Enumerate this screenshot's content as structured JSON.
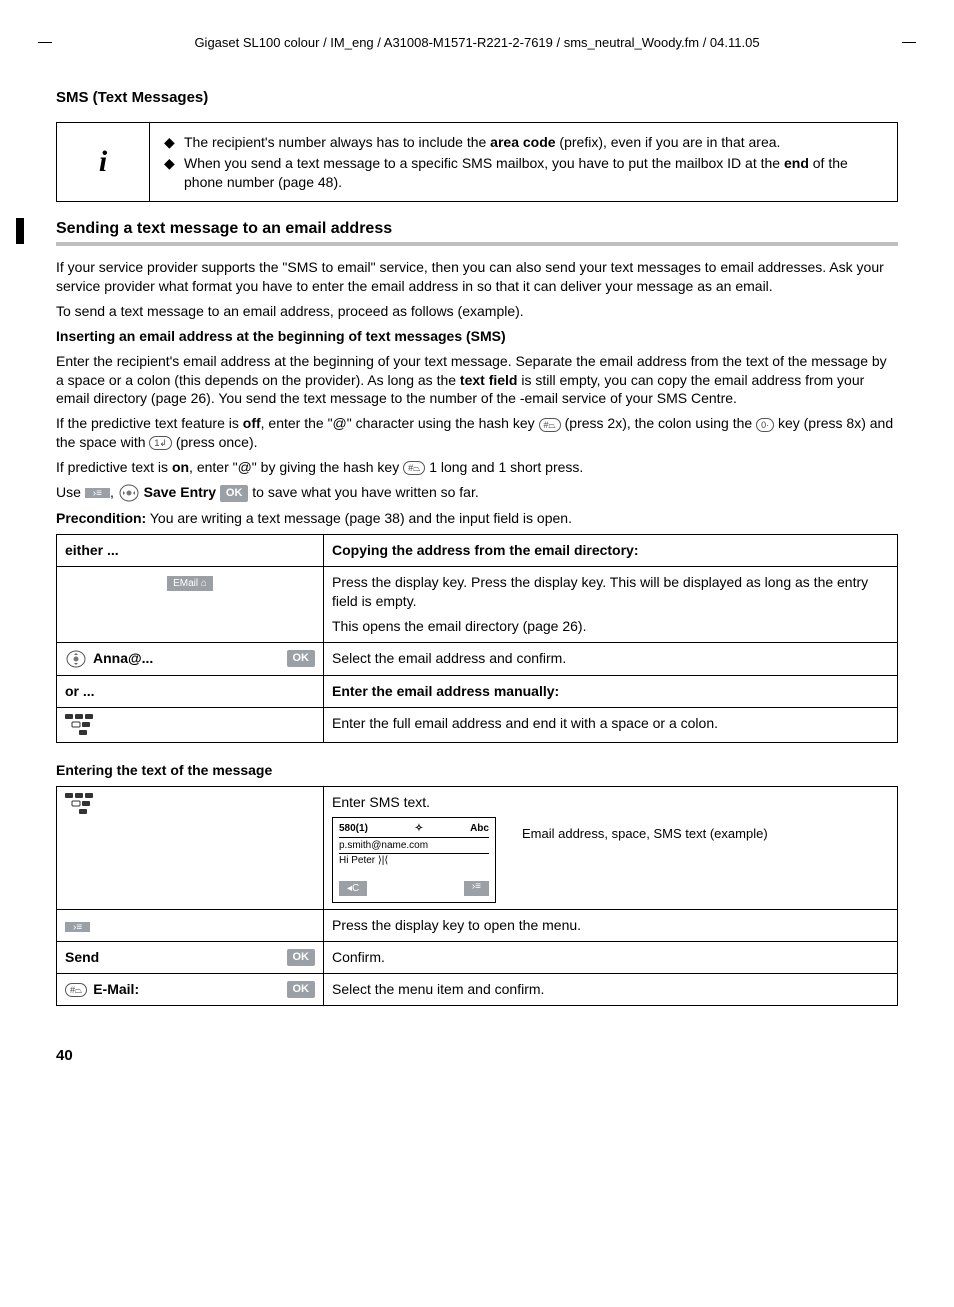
{
  "header_path": "Gigaset SL100 colour / IM_eng / A31008-M1571-R221-2-7619 / sms_neutral_Woody.fm / 04.11.05",
  "section_title": "SMS (Text Messages)",
  "info_icon": "i",
  "info_bullets": [
    {
      "pre": "The recipient's number always has to include the ",
      "b1": "area code",
      "post": " (prefix), even if you are in that area."
    },
    {
      "pre": "When you send a text message to a specific SMS mailbox, you have to put the mailbox ID at the ",
      "b1": "end",
      "post": " of the phone number (page 48)."
    }
  ],
  "subheading": "Sending a text message to an email address",
  "para1": "If your service provider supports the \"SMS to email\" service, then you can also send your text messages to email addresses. Ask your service provider what format you have to enter the email address in so that it can deliver your message as an email.",
  "para2": "To send a text message to an email address, proceed as follows (example).",
  "mini1": "Inserting an email address at the beginning of text messages (SMS)",
  "para3a": "Enter the recipient's email address at the beginning of your text message. Separate the email address from the text of the message by a space or a colon (this depends on the provider). As long as the ",
  "para3b": "text field",
  "para3c": " is still empty, you can copy the email address from your email directory (page 26). You send the text message to the number of the -email service of your SMS Centre.",
  "para4a": "If the predictive text feature is ",
  "off": "off",
  "para4b": ", enter the \"@\" character using the hash key ",
  "para4c": " (press 2x), the colon using the ",
  "para4d": " key (press 8x) and the space with ",
  "para4e": " (press once).",
  "para5a": "If predictive text is ",
  "on": "on",
  "para5b": ", enter \"@\" by giving the hash key ",
  "para5c": " 1 long and 1 short press.",
  "use_line_a": "Use  ",
  "use_line_b": ",  ",
  "save_entry": "Save Entry",
  "use_line_c": "  to save what you have written so far.",
  "precond_label": "Precondition:",
  "precond_text": " You are writing a text message (page 38) and the input field is open.",
  "t1": {
    "r1c1": "either ...",
    "r1c2": "Copying the address from the email directory:",
    "r2c1_badge": "EMail",
    "r2c2a": "Press the display key. Press the display key. This will be displayed as long as the entry field is empty.",
    "r2c2b": "This opens the email directory (page 26).",
    "r3c1_label": "Anna@...",
    "r3c1_ok": "OK",
    "r3c2": "Select the email address and confirm.",
    "r4c1": "or ...",
    "r4c2": "Enter the email address manually:",
    "r5c2": "Enter the full email address and end it with a space or a colon."
  },
  "mini2": "Entering the text of the message",
  "t2": {
    "r1c2_top": "Enter SMS text.",
    "screen_580": "580(1)",
    "screen_abc": "Abc",
    "screen_email": "p.smith@name.com",
    "screen_hi": "Hi Peter",
    "right_note1": "Email address, space, SMS text (example)",
    "r2c2": "Press the display key to open the menu.",
    "r3c1_label": "Send",
    "r3c1_ok": "OK",
    "r3c2": "Confirm.",
    "r4c1_label": "E-Mail:",
    "r4c1_ok": "OK",
    "r4c2": "Select the menu item and confirm."
  },
  "ok_badge": "OK",
  "page_number": "40"
}
